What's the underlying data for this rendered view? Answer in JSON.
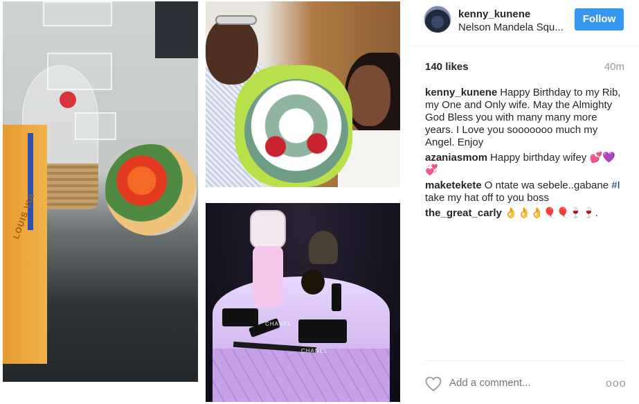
{
  "post": {
    "username": "kenny_kunene",
    "location": "Nelson Mandela Squ...",
    "follow_label": "Follow",
    "likes": "140 likes",
    "time": "40m"
  },
  "photos": {
    "bag_brand": "LOUIS VUI",
    "cake_brand_1": "CHANEL",
    "cake_brand_2": "CHANEL"
  },
  "comments": [
    {
      "user": "kenny_kunene",
      "text": "Happy Birthday to my Rib, my One and Only wife. May the Almighty God Bless you with many many more years. I Love you sooooooo much my Angel. Enjoy"
    },
    {
      "user": "azaniasmom",
      "text": "Happy birthday wifey 💕💜💞"
    },
    {
      "user": "maketekete",
      "text_before": "O ntate wa sebele..gabane ",
      "hashtag": "#I",
      "text_after": " take my hat off to you boss"
    },
    {
      "user": "the_great_carly",
      "text": "👌👌👌🎈🎈🍷🍷."
    }
  ],
  "footer": {
    "add_comment_placeholder": "Add a comment...",
    "more_label": "ooo"
  },
  "colors": {
    "accent": "#3897f0",
    "text": "#262626",
    "muted": "#999999"
  }
}
